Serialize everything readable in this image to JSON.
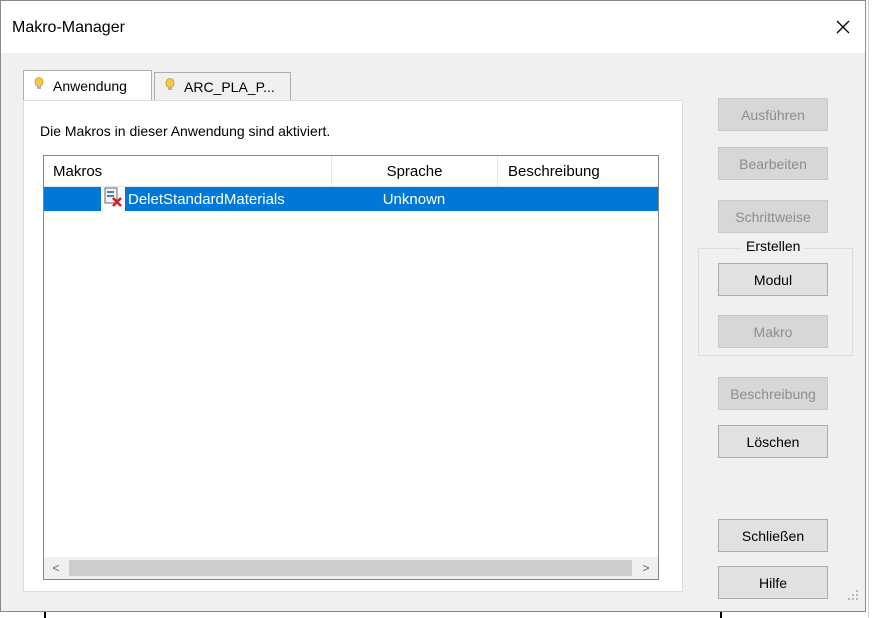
{
  "window": {
    "title": "Makro-Manager",
    "close_glyph": "✕"
  },
  "tabs": [
    {
      "label": "Anwendung",
      "icon": "lightbulb-icon",
      "active": true
    },
    {
      "label": "ARC_PLA_P...",
      "icon": "lightbulb-icon",
      "active": false
    }
  ],
  "panel": {
    "message": "Die Makros in dieser Anwendung sind aktiviert."
  },
  "list": {
    "columns": [
      "Makros",
      "Sprache",
      "Beschreibung"
    ],
    "rows": [
      {
        "name": "DeletStandardMaterials",
        "language": "Unknown",
        "description": "",
        "icon": "macro-error-icon",
        "selected": true
      }
    ],
    "scroll_left": "<",
    "scroll_right": ">"
  },
  "buttons": {
    "run": "Ausführen",
    "edit": "Bearbeiten",
    "step": "Schrittweise",
    "create_group": "Erstellen",
    "module": "Modul",
    "macro": "Makro",
    "description": "Beschreibung",
    "delete": "Löschen",
    "close": "Schließen",
    "help": "Hilfe"
  },
  "colors": {
    "selection": "#0078d7",
    "dialog_bg": "#f0f0f0"
  }
}
